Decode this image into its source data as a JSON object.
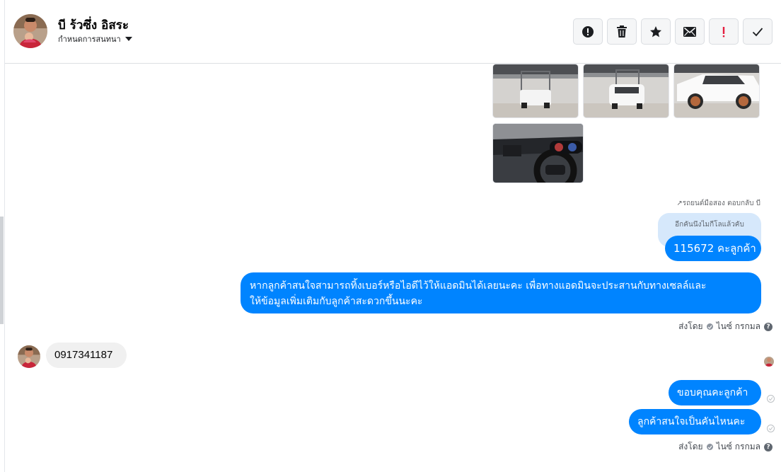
{
  "header": {
    "contact_name": "บี ร้วซึ่ง อิสระ",
    "conversation_label": "กำหนดการสนทนา",
    "actions": [
      "report-icon",
      "trash-icon",
      "star-icon",
      "mail-icon",
      "exclamation-icon",
      "check-icon"
    ]
  },
  "thread": {
    "reply_note": "↗รถยนต์มือสอง ตอบกลับ บี",
    "quoted_text": "อีกคันนึงไมกีโลแล้วคับ",
    "msg_price": "115672 คะลูกค้า",
    "msg_contact_line1": "หากลูกค้าสนใจสามารถทิ้งเบอร์หรือไอดีไว้ให้แอดมินได้เลยนะคะ เพื่อทางแอดมินจะประสานกับทางเซลล์และ",
    "msg_contact_line2": "ให้ข้อมูลเพิ่มเติมกับลูกค้าสะดวกขึ้นนะคะ",
    "sent_by_1": "ส่งโดย",
    "sender_1": "ไนซ์ กรกมล",
    "incoming_phone": "0917341187",
    "msg_thanks": "ขอบคุณคะลูกค้า",
    "msg_question": "ลูกค้าสนใจเป็นคันไหนคะ",
    "sent_by_2": "ส่งโดย",
    "sender_2": "ไนซ์ กรกมล",
    "help_glyph": "?"
  },
  "colors": {
    "outgoing_bubble": "#0084ff",
    "incoming_bubble": "#f0f0f0",
    "quoted_bubble": "#d6e8fb",
    "exclamation_red": "#e41e3f"
  }
}
